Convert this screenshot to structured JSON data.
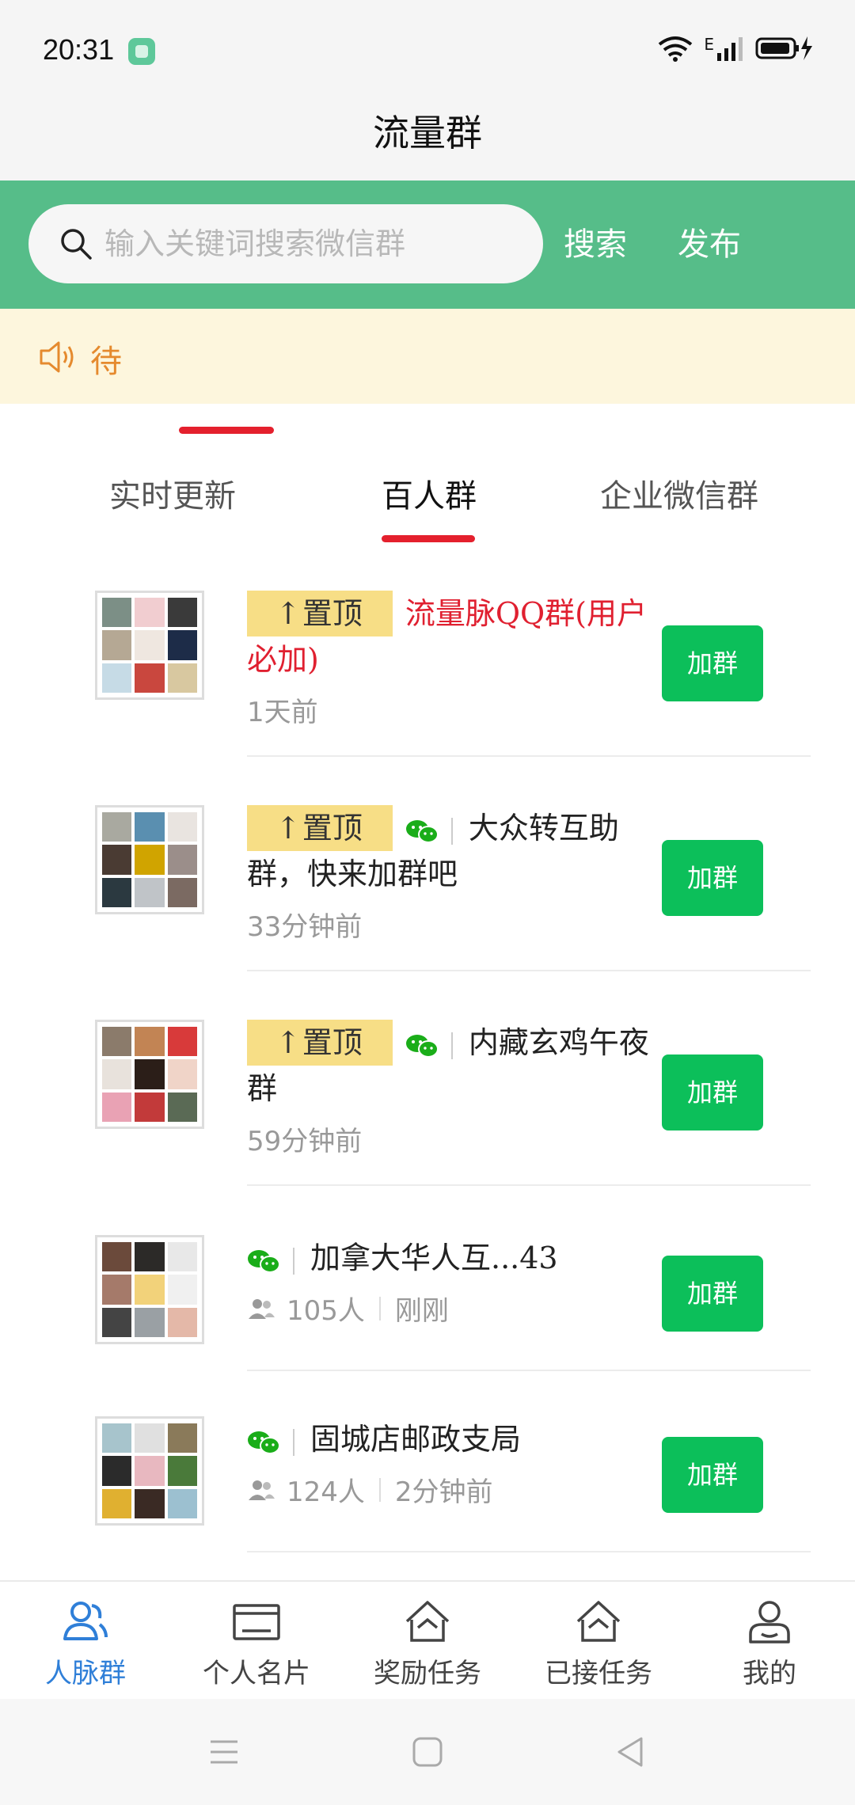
{
  "status": {
    "time": "20:31",
    "network": "E"
  },
  "header": {
    "title": "流量群"
  },
  "search": {
    "placeholder": "输入关键词搜索微信群",
    "search_label": "搜索",
    "publish_label": "发布"
  },
  "notice": {
    "text": "待"
  },
  "tabs": [
    {
      "label": "实时更新",
      "active": false
    },
    {
      "label": "百人群",
      "active": true
    },
    {
      "label": "企业微信群",
      "active": false
    }
  ],
  "pin_label": "置顶",
  "join_label": "加群",
  "groups": [
    {
      "title": "流量脉QQ群(用户",
      "title2": "必加)",
      "time": "1天前",
      "pinned": true,
      "wechat": false,
      "red": true
    },
    {
      "title": "大众转互助",
      "title2": "群，快来加群吧",
      "time": "33分钟前",
      "pinned": true,
      "wechat": true
    },
    {
      "title": "内藏玄鸡午夜",
      "title2": "群",
      "time": "59分钟前",
      "pinned": true,
      "wechat": true
    },
    {
      "title": "加拿大华人互...43",
      "members": "105人",
      "time": "刚刚",
      "pinned": false,
      "wechat": true
    },
    {
      "title": "固城店邮政支局",
      "members": "124人",
      "time": "2分钟前",
      "pinned": false,
      "wechat": true
    }
  ],
  "bottom_nav": [
    {
      "label": "人脉群",
      "active": true
    },
    {
      "label": "个人名片",
      "active": false
    },
    {
      "label": "奖励任务",
      "active": false
    },
    {
      "label": "已接任务",
      "active": false
    },
    {
      "label": "我的",
      "active": false
    }
  ],
  "colors": {
    "green_band": "#56bd89",
    "join_green": "#0cbf5a",
    "accent_red": "#e4202d",
    "pin_yellow": "#f7de86",
    "nav_blue": "#2f7fd8"
  }
}
